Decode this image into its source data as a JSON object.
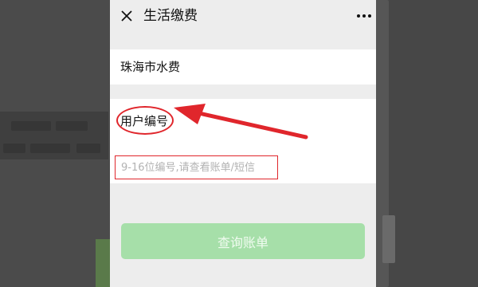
{
  "header": {
    "title": "生活缴费"
  },
  "company": {
    "name": "珠海市水费"
  },
  "account": {
    "label": "用户编号",
    "placeholder": "9-16位编号,请查看账单/短信",
    "value": ""
  },
  "actions": {
    "query_label": "查询账单"
  },
  "colors": {
    "annotation": "#e0262c",
    "button_disabled": "#a6dfa9",
    "page_bg": "#ededed"
  },
  "icons": {
    "close": "close-icon",
    "more": "more-icon"
  }
}
